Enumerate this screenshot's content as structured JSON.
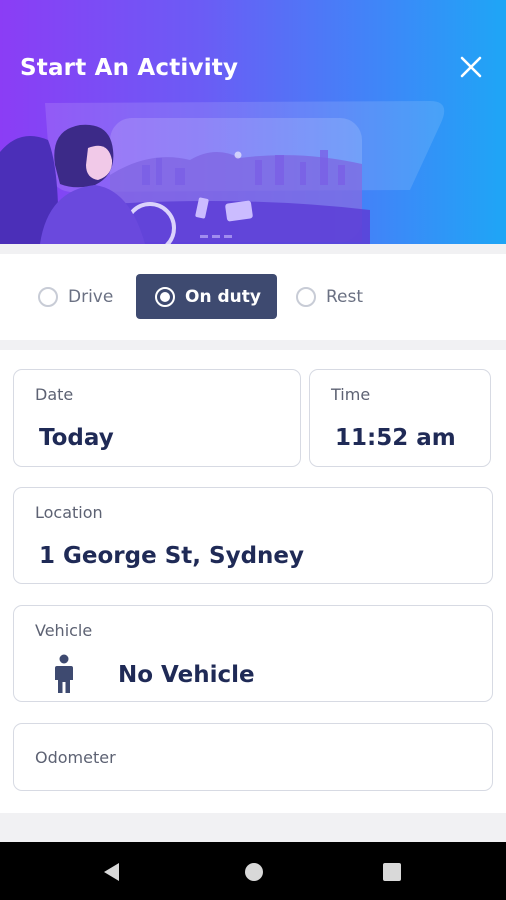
{
  "header": {
    "title": "Start An Activity",
    "close_icon": "close-icon"
  },
  "modes": [
    {
      "label": "Drive",
      "selected": false
    },
    {
      "label": "On duty",
      "selected": true
    },
    {
      "label": "Rest",
      "selected": false
    }
  ],
  "form": {
    "date": {
      "label": "Date",
      "value": "Today"
    },
    "time": {
      "label": "Time",
      "value": "11:52 am"
    },
    "location": {
      "label": "Location",
      "value": "1 George St, Sydney"
    },
    "vehicle": {
      "label": "Vehicle",
      "value": "No Vehicle",
      "icon": "person-icon"
    },
    "odometer": {
      "label": "Odometer"
    }
  },
  "navbar": {
    "icons": [
      "back-icon",
      "home-icon",
      "recents-icon"
    ]
  },
  "colors": {
    "header_start": "#8b3df5",
    "header_end": "#1ea6f6",
    "selected_mode_bg": "#3e4a70",
    "text_primary": "#1f2a56"
  }
}
